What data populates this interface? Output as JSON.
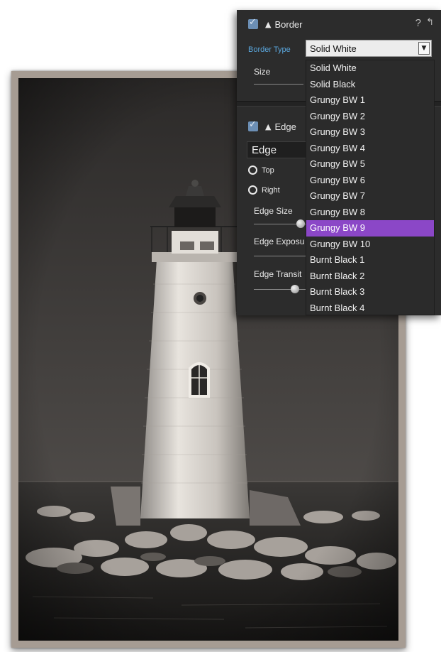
{
  "border_panel": {
    "title": "Border",
    "help_glyph": "?",
    "type_label": "Border Type",
    "selected_type": "Solid White",
    "size_label": "Size",
    "options": [
      "Solid White",
      "Solid Black",
      "Grungy BW 1",
      "Grungy BW 2",
      "Grungy BW 3",
      "Grungy BW 4",
      "Grungy BW 5",
      "Grungy BW 6",
      "Grungy BW 7",
      "Grungy BW 8",
      "Grungy BW 9",
      "Grungy BW 10",
      "Burnt Black 1",
      "Burnt Black 2",
      "Burnt Black 3",
      "Burnt Black 4"
    ],
    "highlighted_option": "Grungy BW 9"
  },
  "edge_panel": {
    "title": "Edge",
    "mode": "Edge",
    "radio_top": "Top",
    "radio_right": "Right",
    "edge_size_label": "Edge Size",
    "edge_exposure_label": "Edge Exposu",
    "edge_transition_label": "Edge Transit"
  },
  "colors": {
    "accent_blue": "#5aa6dc",
    "highlight_purple": "#8b47c7",
    "checkbox": "#6c8fb5"
  },
  "icons": {
    "enabled_check": "check-icon",
    "collapse": "triangle-up-icon",
    "help": "help-icon",
    "reset": "reset-arrow-icon",
    "dropdown": "chevron-down-icon"
  },
  "photo": {
    "subject": "lighthouse-photo"
  }
}
